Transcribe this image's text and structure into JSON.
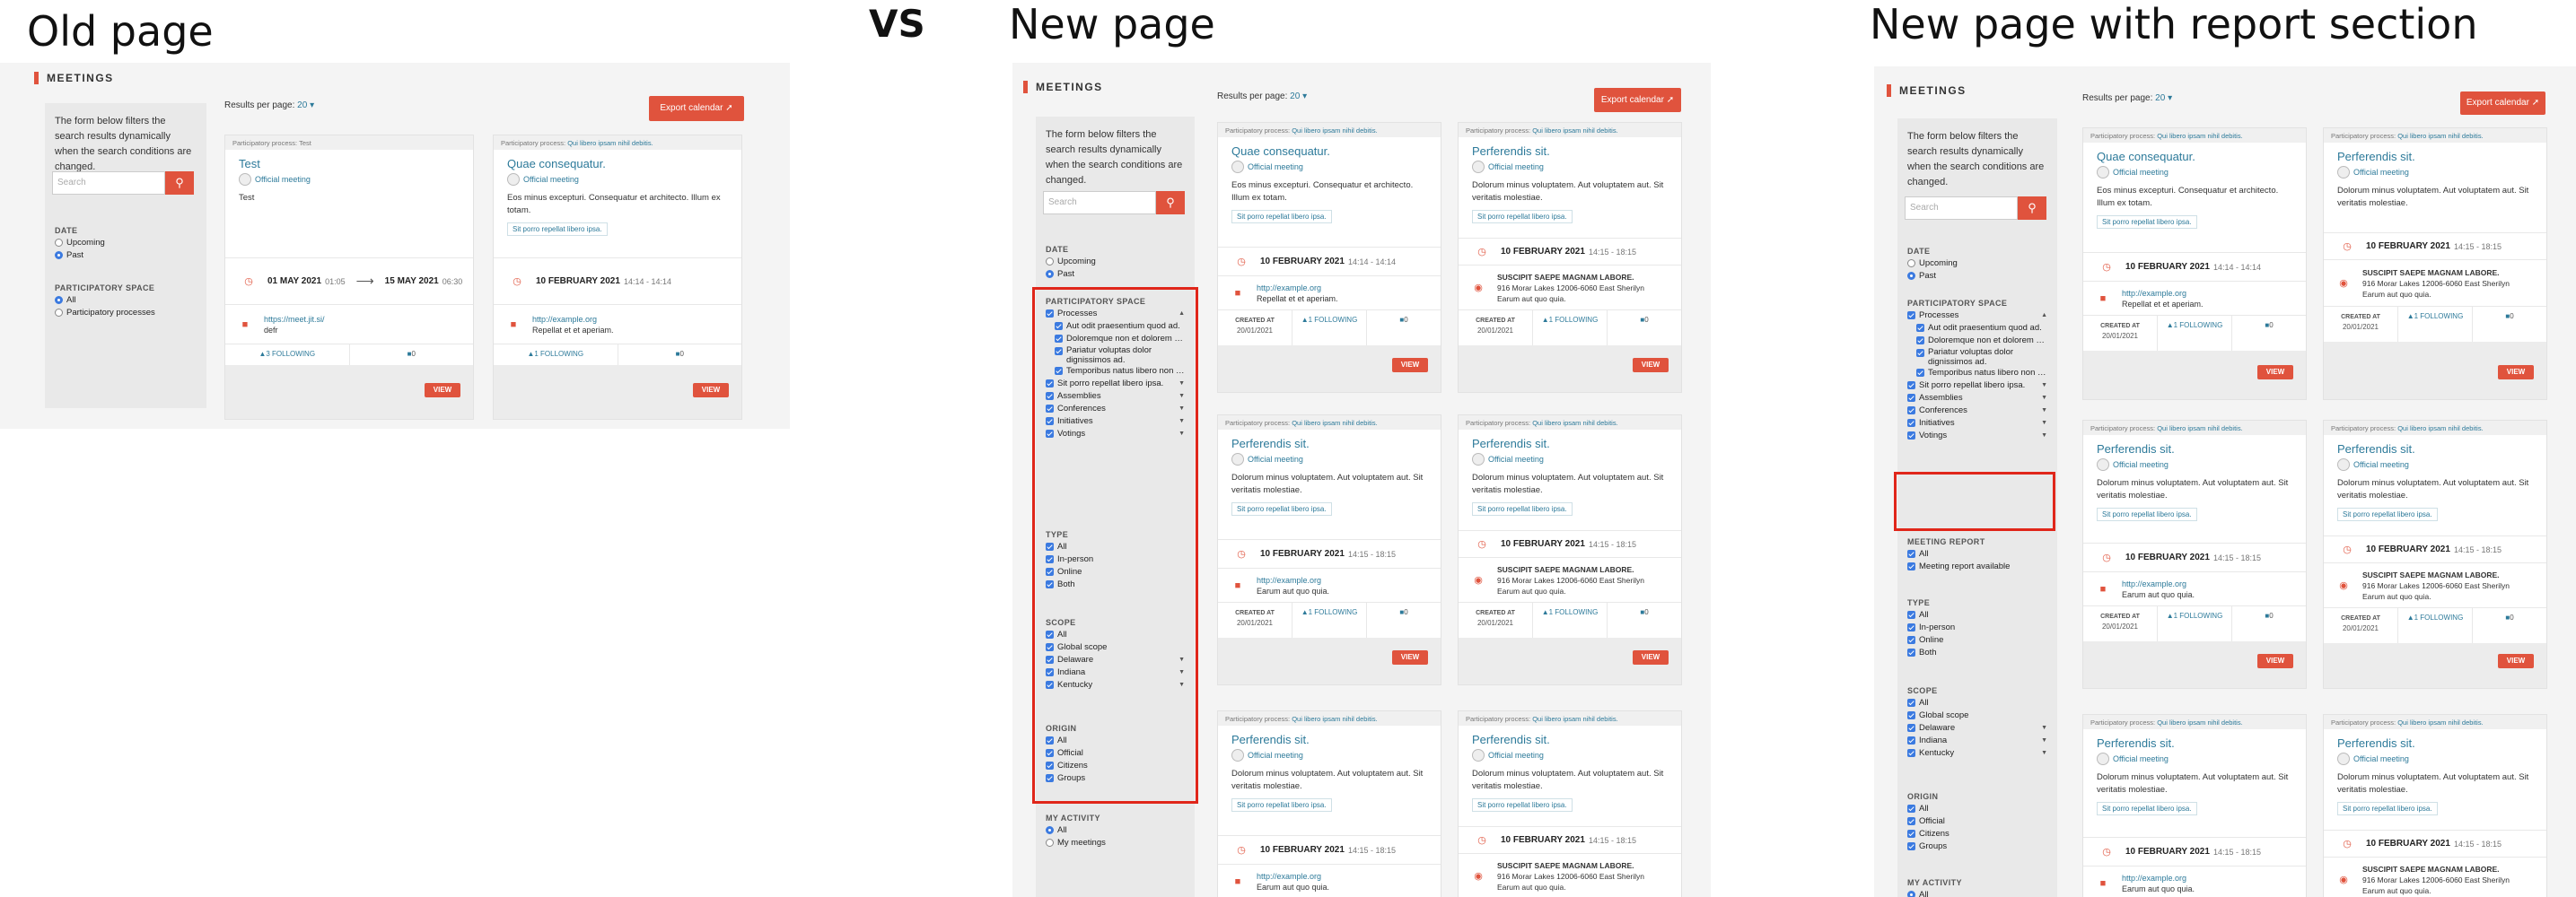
{
  "titles": {
    "old": "Old page",
    "vs": "VS",
    "new": "New page",
    "report": "New page with report section"
  },
  "common": {
    "meetings_header": "MEETINGS",
    "intro": "The form below filters the search results dynamically when the search conditions are changed.",
    "search_placeholder": "Search",
    "results_per_page_label": "Results per page:",
    "results_per_page_value": "20",
    "export_label": "Export calendar",
    "view_label": "VIEW",
    "created_at_label": "CREATED AT",
    "created_at_value": "20/01/2021"
  },
  "filters": {
    "date": {
      "label": "DATE",
      "upcoming": "Upcoming",
      "past": "Past"
    },
    "space": {
      "label": "PARTICIPATORY SPACE",
      "all": "All",
      "processes_short": "Participatory processes",
      "processes": "Processes",
      "p1": "Aut odit praesentium quod ad.",
      "p2": "Doloremque non et dolorem sed.",
      "p3": "Pariatur voluptas dolor dignissimos ad.",
      "p4": "Temporibus natus libero non rem.",
      "p5": "Sit porro repellat libero ipsa.",
      "assemblies": "Assemblies",
      "conferences": "Conferences",
      "initiatives": "Initiatives",
      "votings": "Votings"
    },
    "report": {
      "label": "MEETING REPORT",
      "all": "All",
      "available": "Meeting report available"
    },
    "type": {
      "label": "TYPE",
      "all": "All",
      "inperson": "In-person",
      "online": "Online",
      "both": "Both"
    },
    "scope": {
      "label": "SCOPE",
      "all": "All",
      "global": "Global scope",
      "delaware": "Delaware",
      "indiana": "Indiana",
      "kentucky": "Kentucky"
    },
    "origin": {
      "label": "ORIGIN",
      "all": "All",
      "official": "Official",
      "citizens": "Citizens",
      "groups": "Groups"
    },
    "activity": {
      "label": "MY ACTIVITY",
      "all": "All",
      "mine": "My meetings"
    }
  },
  "cards": {
    "pp_label": "Participatory process:",
    "pp_test": "Test",
    "pp_qui": "Qui libero ipsam nihil debitis.",
    "official": "Official meeting",
    "tag": "Sit porro repellat libero ipsa.",
    "test": {
      "title": "Test",
      "desc": "Test",
      "start_date": "01 MAY 2021",
      "start_time": "01:05",
      "end_date": "15 MAY 2021",
      "end_time": "06:30",
      "link": "https://meet.jit.si/",
      "link_sub": "defr",
      "following": "3 FOLLOWING",
      "comments": "0"
    },
    "quae": {
      "title": "Quae consequatur.",
      "desc": "Eos minus excepturi. Consequatur et architecto. Illum ex totam.",
      "date": "10 FEBRUARY 2021",
      "time": "14:14 - 14:14",
      "link": "http://example.org",
      "link_sub": "Repellat et et aperiam.",
      "following": "1 FOLLOWING",
      "comments": "0"
    },
    "perf": {
      "title": "Perferendis sit.",
      "desc": "Dolorum minus voluptatem. Aut voluptatem aut. Sit veritatis molestiae.",
      "date": "10 FEBRUARY 2021",
      "time": "14:15 - 18:15",
      "link": "http://example.org",
      "link_sub": "Earum aut quo quia.",
      "addr_title": "SUSCIPIT SAEPE MAGNAM LABORE.",
      "addr": "916 Morar Lakes 12006-6060 East Sherilyn",
      "addr_sub": "Earum aut quo quia.",
      "following": "1 FOLLOWING",
      "comments": "0"
    }
  },
  "icons": {
    "search": "search-icon",
    "calendar": "calendar-icon",
    "video": "video-camera-icon",
    "pin": "map-pin-icon",
    "comment": "comment-icon",
    "arrow": "arrow-right-icon"
  },
  "colors": {
    "accent": "#e0533d",
    "link": "#2d7a9a",
    "checkbox": "#3b7ae0",
    "highlight": "#e0261a"
  }
}
